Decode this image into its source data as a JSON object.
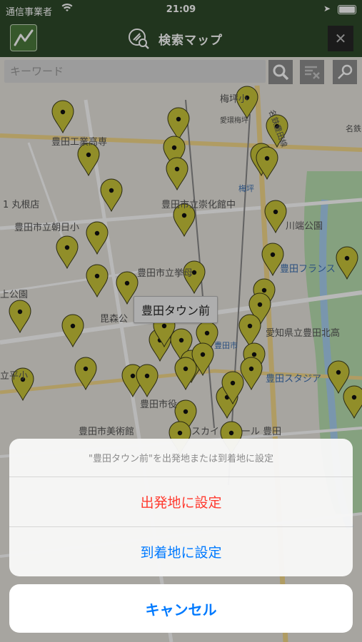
{
  "status_bar": {
    "carrier": "通信事業者",
    "time": "21:09"
  },
  "header": {
    "title": "検索マップ",
    "close_label": "✕"
  },
  "search": {
    "placeholder": "キーワード"
  },
  "colors": {
    "header": "#2e4a2a",
    "pin": "#c9c53a",
    "accent": "#007aff",
    "destructive": "#ff3b30"
  },
  "map": {
    "labels": [
      "梅坪小",
      "豊田工業高専",
      "愛環梅坪",
      "梅坪",
      "1 丸根店",
      "豊田市立崇化館中",
      "豊田市立朝日小",
      "川端公園",
      "豊田市立挙母",
      "豊田フランス",
      "上公園",
      "毘森公",
      "愛知県立豊田北高",
      "豊田市",
      "豊田スタジア",
      "豊田市美術館",
      "スカイ",
      "ール 豊田",
      "名鉄豊田線",
      "名鉄",
      "豊田市役",
      "立平小"
    ],
    "callout": "豊田タウン前"
  },
  "action_sheet": {
    "message": "\"豊田タウン前\"を出発地または到着地に設定",
    "set_departure": "出発地に設定",
    "set_arrival": "到着地に設定",
    "cancel": "キャンセル"
  }
}
